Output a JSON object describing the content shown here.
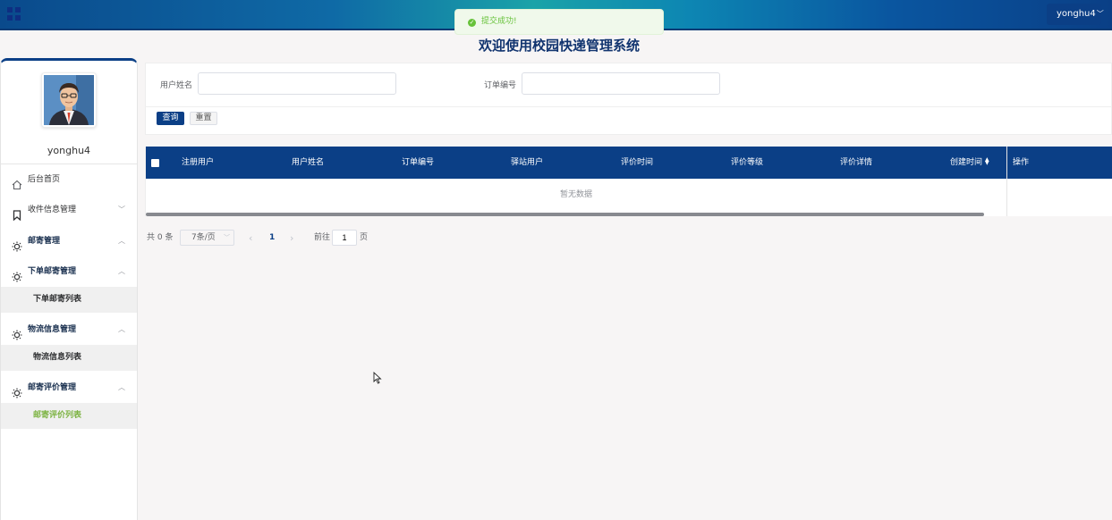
{
  "topbar": {
    "user_label": "yonghu4",
    "menu_icon": "grid-icon"
  },
  "toast": {
    "message": "提交成功!",
    "icon": "check-circle-icon",
    "color": "#67c23a"
  },
  "page_title": "欢迎使用校园快递管理系统",
  "sidebar": {
    "username": "yonghu4",
    "menu": [
      {
        "label": "后台首页",
        "icon": "home-icon"
      },
      {
        "label": "收件信息管理",
        "icon": "bookmark-icon",
        "arrow": "﹀"
      },
      {
        "label": "邮寄管理",
        "icon": "sun-icon",
        "arrow": "︿"
      },
      {
        "label": "下单邮寄管理",
        "icon": "sun-icon",
        "arrow": "︿"
      },
      {
        "label": "物流信息管理",
        "icon": "sun-icon",
        "arrow": "︿"
      },
      {
        "label": "邮寄评价管理",
        "icon": "sun-icon",
        "arrow": "︿"
      }
    ],
    "submenus": [
      {
        "label": "下单邮寄列表"
      },
      {
        "label": "物流信息列表"
      },
      {
        "label": "邮寄评价列表",
        "active": true
      }
    ]
  },
  "search": {
    "username_label": "用户姓名",
    "username_value": "",
    "order_label": "订单编号",
    "order_value": "",
    "query_button": "查询",
    "reset_button": "重置"
  },
  "table": {
    "columns": [
      "注册用户",
      "用户姓名",
      "订单编号",
      "驿站用户",
      "评价时间",
      "评价等级",
      "评价详情",
      "创建时间",
      "操作"
    ],
    "empty_text": "暂无数据",
    "rows": []
  },
  "pagination": {
    "total_text": "共 0 条",
    "page_size": "7条/页",
    "prev": "‹",
    "current_page": "1",
    "next": "›",
    "goto_label": "前往",
    "goto_value": "1",
    "page_suffix": "页"
  },
  "colors": {
    "primary": "#0b3f86",
    "success": "#67c23a",
    "active_menu": "#7cb342"
  }
}
